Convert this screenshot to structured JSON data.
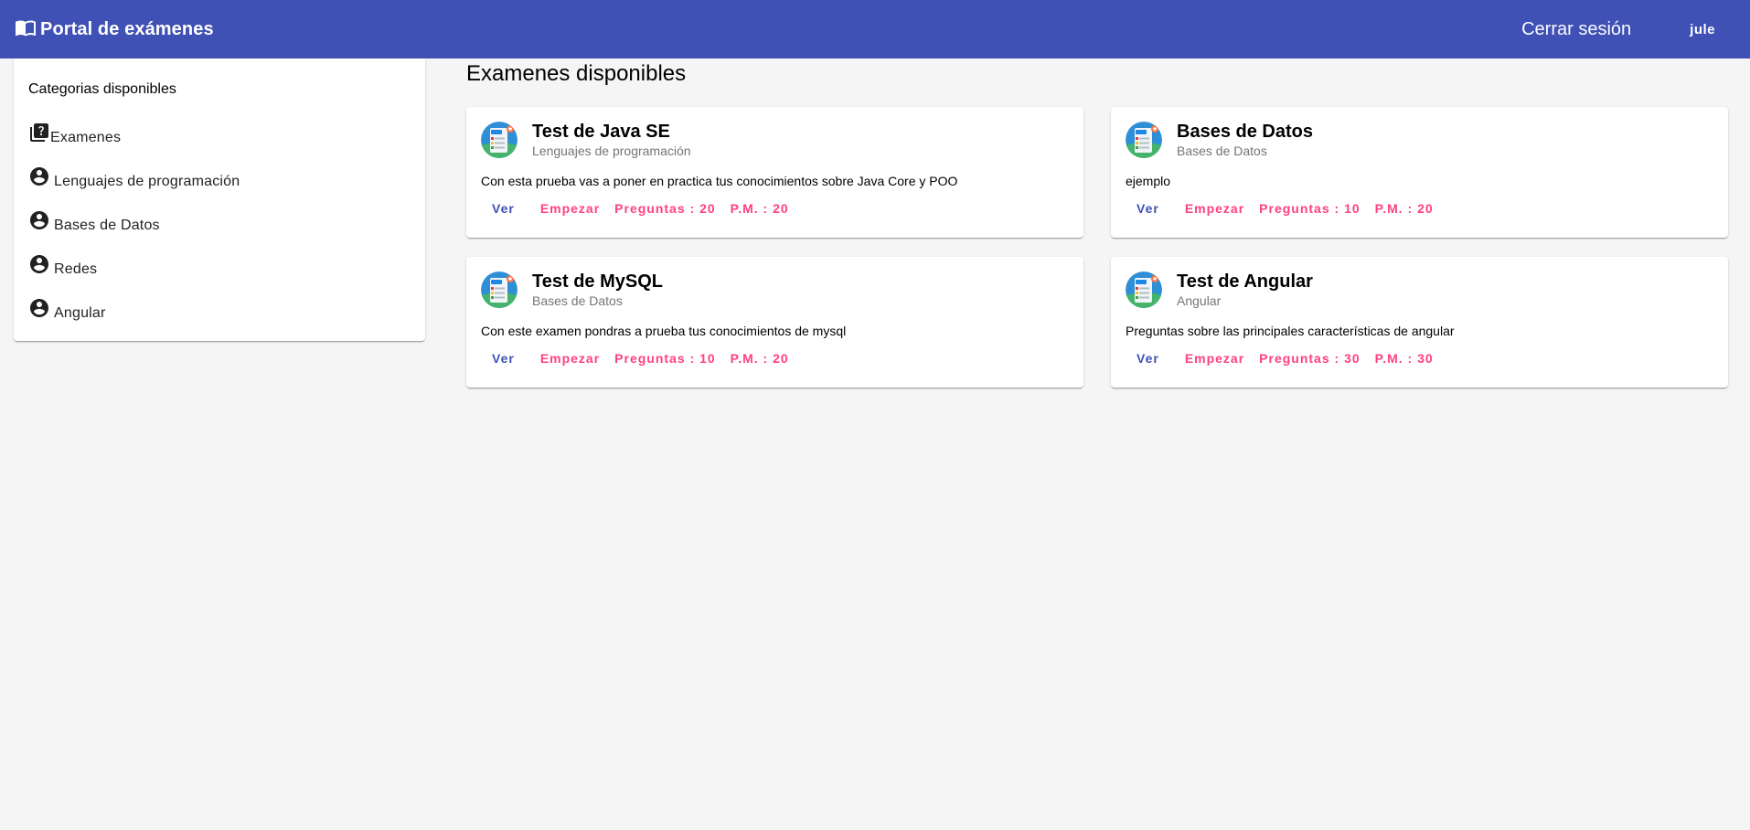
{
  "toolbar": {
    "brand_icon": "book-open-icon",
    "title": "Portal de exámenes",
    "logout_label": "Cerrar sesión",
    "user_label": "jule",
    "background_color": "#3f51b5"
  },
  "sidebar": {
    "title": "Categorias disponibles",
    "items": [
      {
        "label": "Examenes",
        "icon": "quiz-icon"
      },
      {
        "label": "Lenguajes de programación",
        "icon": "account-circle-icon"
      },
      {
        "label": "Bases de Datos",
        "icon": "account-circle-icon"
      },
      {
        "label": "Redes",
        "icon": "account-circle-icon"
      },
      {
        "label": "Angular",
        "icon": "account-circle-icon"
      }
    ]
  },
  "main": {
    "title": "Examenes disponibles",
    "cards": [
      {
        "title": "Test de Java SE",
        "subtitle": "Lenguajes de programación",
        "description": "Con esta prueba vas a poner en practica tus conocimientos sobre Java Core y POO",
        "view_label": "Ver",
        "start_label": "Empezar",
        "questions_label": "Preguntas : 20",
        "max_points_label": "P.M. : 20"
      },
      {
        "title": "Bases de Datos",
        "subtitle": "Bases de Datos",
        "description": "ejemplo",
        "view_label": "Ver",
        "start_label": "Empezar",
        "questions_label": "Preguntas : 10",
        "max_points_label": "P.M. : 20"
      },
      {
        "title": "Test de MySQL",
        "subtitle": "Bases de Datos",
        "description": "Con este examen pondras a prueba tus conocimientos de mysql",
        "view_label": "Ver",
        "start_label": "Empezar",
        "questions_label": "Preguntas : 10",
        "max_points_label": "P.M. : 20"
      },
      {
        "title": "Test de Angular",
        "subtitle": "Angular",
        "description": "Preguntas sobre las principales características de angular",
        "view_label": "Ver",
        "start_label": "Empezar",
        "questions_label": "Preguntas : 30",
        "max_points_label": "P.M. : 30"
      }
    ]
  },
  "colors": {
    "primary": "#3f51b5",
    "accent": "#ff4081",
    "background": "#f5f5f5"
  }
}
